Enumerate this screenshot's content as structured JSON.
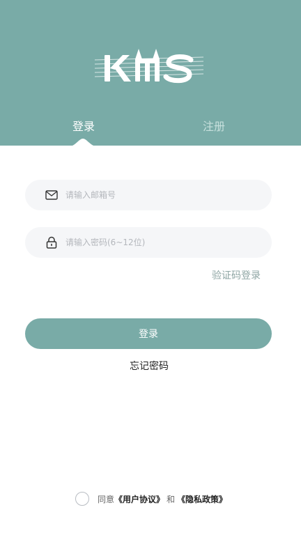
{
  "brand": {
    "logo_text": "KMS",
    "color": "#79aba7"
  },
  "tabs": {
    "login": "登录",
    "register": "注册"
  },
  "form": {
    "email": {
      "placeholder": "请输入邮箱号",
      "value": "",
      "icon": "mail-icon"
    },
    "password": {
      "placeholder": "请输入密码(6~12位)",
      "value": "",
      "icon": "lock-icon"
    },
    "code_login_label": "验证码登录",
    "login_button_label": "登录",
    "forgot_label": "忘记密码"
  },
  "agreement": {
    "prefix": "同意",
    "user_agreement": "《用户协议》",
    "conjunction": "和",
    "privacy_policy": "《隐私政策》",
    "checked": false
  }
}
